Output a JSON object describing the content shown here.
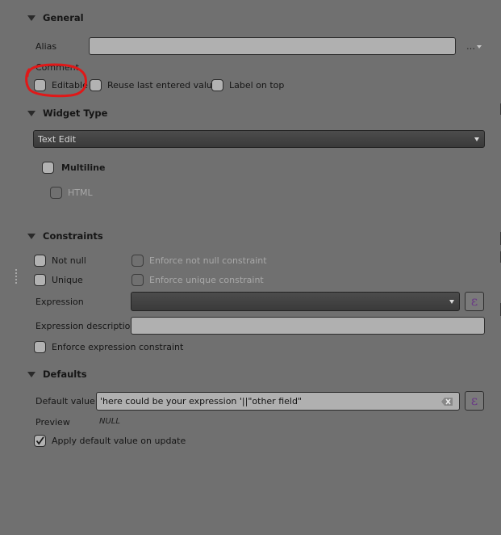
{
  "general": {
    "title": "General",
    "alias_label": "Alias",
    "alias_value": "",
    "more_button": "…",
    "comment_label": "Comment",
    "editable_label": "Editable",
    "editable_checked": false,
    "reuse_label": "Reuse last entered value",
    "reuse_checked": false,
    "label_on_top_label": "Label on top",
    "label_on_top_checked": false
  },
  "widget_type": {
    "title": "Widget Type",
    "selected": "Text Edit",
    "multiline_label": "Multiline",
    "multiline_checked": false,
    "html_label": "HTML",
    "html_checked": false
  },
  "constraints": {
    "title": "Constraints",
    "not_null_label": "Not null",
    "enforce_not_null_label": "Enforce not null constraint",
    "unique_label": "Unique",
    "enforce_unique_label": "Enforce unique constraint",
    "expression_label": "Expression",
    "expression_value": "",
    "expression_button": "ε",
    "expression_description_label": "Expression description",
    "expression_description_value": "",
    "enforce_expression_label": "Enforce expression constraint"
  },
  "defaults": {
    "title": "Defaults",
    "default_value_label": "Default value",
    "default_value": "'here could be your expression '||\"other field\"",
    "expression_button": "ε",
    "preview_label": "Preview",
    "preview_value": "NULL",
    "apply_on_update_label": "Apply default value on update",
    "apply_on_update_checked": true
  },
  "annotation": {
    "color": "#e01818",
    "target": "editable-checkbox"
  }
}
